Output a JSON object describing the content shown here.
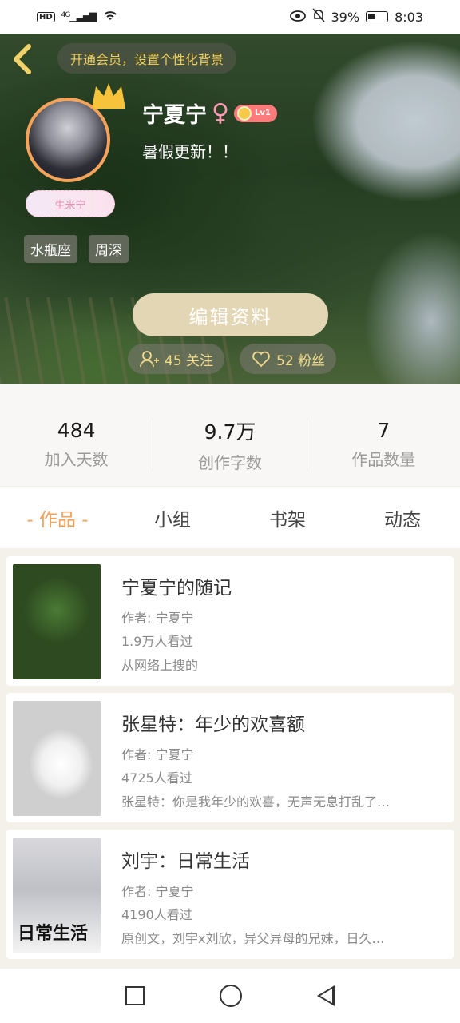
{
  "status_bar": {
    "hd": "HD",
    "network": "4G",
    "battery": "39%",
    "time": "8:03"
  },
  "header": {
    "back_icon": "chevron-left-icon",
    "vip_text": "开通会员，设置个性化背景"
  },
  "profile": {
    "username": "宁夏宁",
    "gender_symbol": "♀",
    "level": "Lv1",
    "signature": "暑假更新！！",
    "member_tag": "生米宁",
    "tags": [
      "水瓶座",
      "周深"
    ],
    "edit_button": "编辑资料",
    "following": "45 关注",
    "fans": "52 粉丝"
  },
  "stats": [
    {
      "value": "484",
      "label": "加入天数"
    },
    {
      "value": "9.7万",
      "label": "创作字数"
    },
    {
      "value": "7",
      "label": "作品数量"
    }
  ],
  "tabs": [
    {
      "label": "- 作品 -",
      "active": true
    },
    {
      "label": "小组",
      "active": false
    },
    {
      "label": "书架",
      "active": false
    },
    {
      "label": "动态",
      "active": false
    }
  ],
  "works": [
    {
      "title": "宁夏宁的随记",
      "author": "作者: 宁夏宁",
      "views": "1.9万人看过",
      "desc": "从网络上搜的"
    },
    {
      "title": "张星特：年少的欢喜额",
      "author": "作者: 宁夏宁",
      "views": "4725人看过",
      "desc": "张星特：你是我年少的欢喜，无声无息打乱了…"
    },
    {
      "title": "刘宇：日常生活",
      "author": "作者: 宁夏宁",
      "views": "4190人看过",
      "desc": "原创文，刘宇x刘欣，异父异母的兄妹，日久…",
      "cover_text": "日常生活"
    }
  ],
  "colors": {
    "accent": "#f0a25a",
    "gold": "#f1cf5a",
    "edit_button_bg": "#e3d6b4"
  }
}
